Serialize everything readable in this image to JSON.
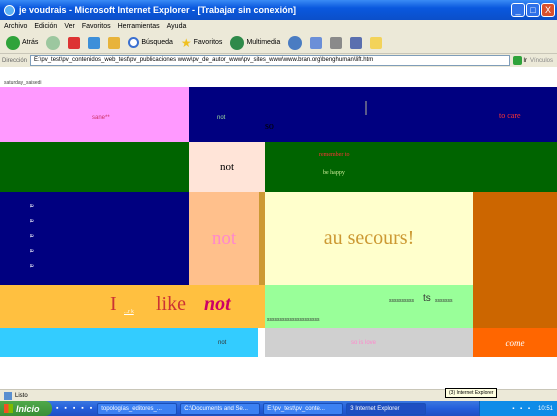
{
  "window": {
    "title": "je voudrais - Microsoft Internet Explorer - [Trabajar sin conexión]",
    "controls": [
      "_",
      "□",
      "X"
    ]
  },
  "menu": [
    "Archivo",
    "Edición",
    "Ver",
    "Favoritos",
    "Herramientas",
    "Ayuda"
  ],
  "toolbar": {
    "back": "Atrás",
    "search": "Búsqueda",
    "favorites": "Favoritos",
    "multimedia": "Multimedia"
  },
  "address": {
    "label": "Dirección",
    "url": "E:\\pv_test\\pv_contenidos_web_test\\pv_publicaciones www\\pv_de_autor_www\\pv_sites_www\\www.bran.org\\benghuman\\lift.htm",
    "go": "Ir",
    "links": "Vínculos"
  },
  "page": {
    "header": "saturday_saisedi",
    "blocks": {
      "pink_text": "sane**",
      "navy_small": "not",
      "navy_mid": "so",
      "navy_right": "to care",
      "not_box": "not",
      "green_line1": "remember to",
      "green_line2": "be happy",
      "navy_left_vertical": "a a a a a",
      "peach_not": "not",
      "au_secours": "au secours!",
      "i_like_not_1": "I",
      "i_like_not_2": "like",
      "i_like_not_3": "not",
      "small_dots": "...r k",
      "underscores": "sssssssssssssssssssss",
      "lime_right": "ssssssssss",
      "lime_ts": "ts",
      "lime_small": "sssssss",
      "cyan_not": "not",
      "grey_text": "so is love",
      "come": "come"
    }
  },
  "status": {
    "text": "Listo",
    "tooltip": "(3) Internet Explorer"
  },
  "taskbar": {
    "start": "Inicio",
    "tasks": [
      "topologías_editores_...",
      "C:\\Documents and Se...",
      "E:\\pv_test\\pv_conte...",
      "3 Internet Explorer"
    ],
    "clock": "10:51"
  },
  "colors": {
    "pink": "#FF99FF",
    "navy": "#000080",
    "dark_green": "#006400",
    "blush": "#FFE4D8",
    "peach": "#FFC08C",
    "light_yellow": "#FFFFCC",
    "orange": "#CC6600",
    "gold": "#FFC040",
    "lime": "#99FF99",
    "cyan": "#33CCFF",
    "grey": "#D0D0D0",
    "bright_orange": "#FF6600"
  }
}
